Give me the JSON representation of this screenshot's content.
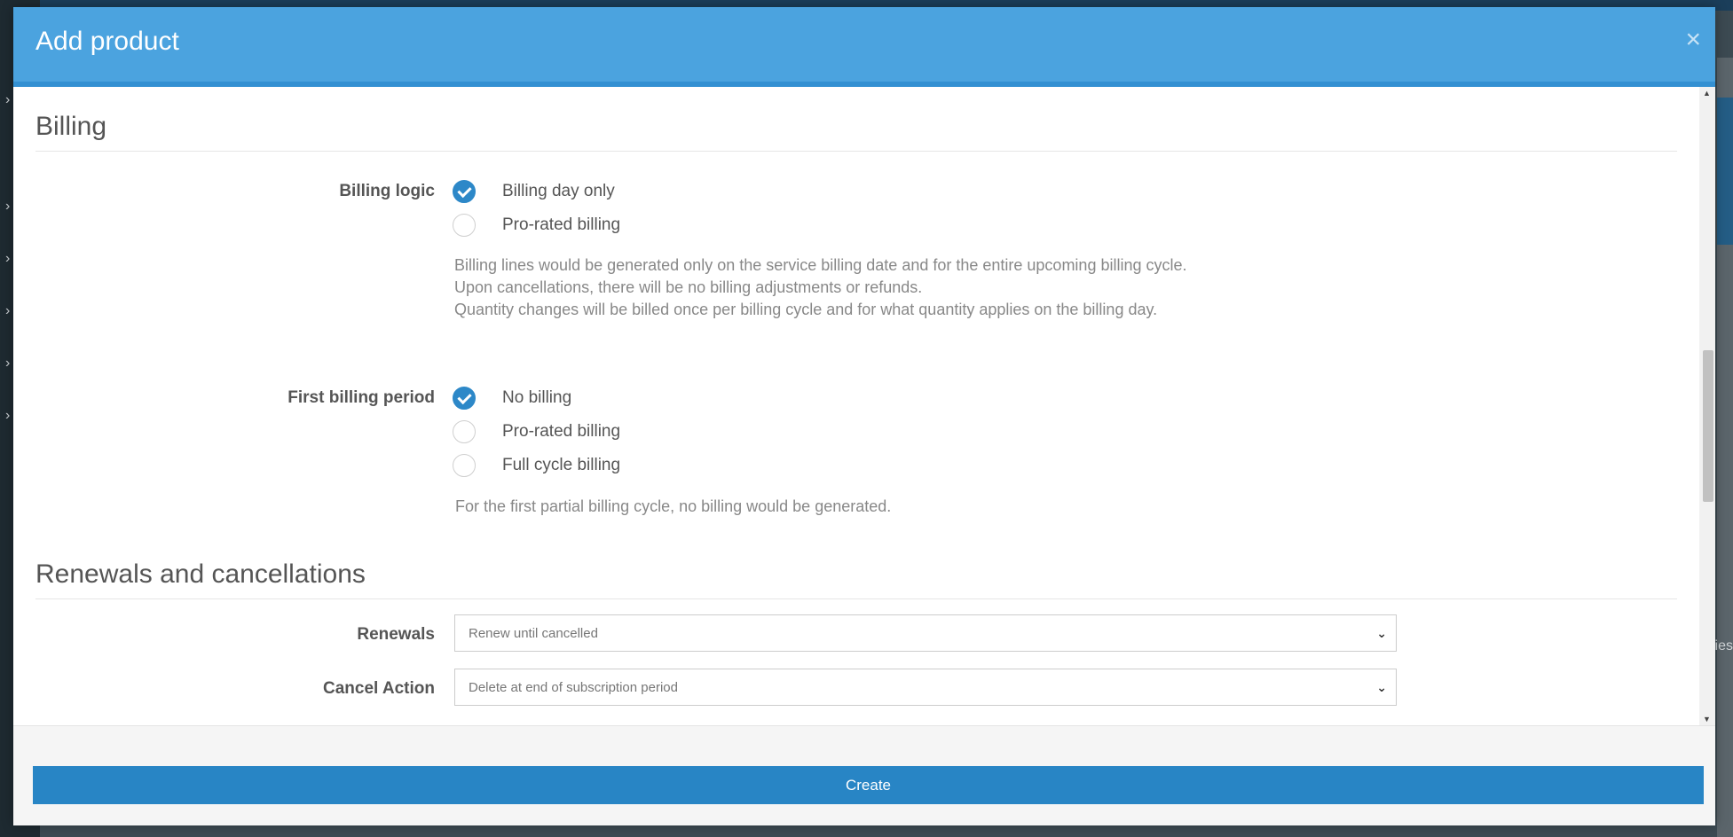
{
  "modal": {
    "title": "Add product",
    "close_glyph": "×"
  },
  "billing": {
    "section_title": "Billing",
    "billing_logic": {
      "label": "Billing logic",
      "options": [
        {
          "label": "Billing day only",
          "checked": true
        },
        {
          "label": "Pro-rated billing",
          "checked": false
        }
      ],
      "help": [
        "Billing lines would be generated only on the service billing date and for the entire upcoming billing cycle.",
        "Upon cancellations, there will be no billing adjustments or refunds.",
        "Quantity changes will be billed once per billing cycle and for what quantity applies on the billing day."
      ]
    },
    "first_billing_period": {
      "label": "First billing period",
      "options": [
        {
          "label": "No billing",
          "checked": true
        },
        {
          "label": "Pro-rated billing",
          "checked": false
        },
        {
          "label": "Full cycle billing",
          "checked": false
        }
      ],
      "help": "For the first partial billing cycle, no billing would be generated."
    }
  },
  "renewals": {
    "section_title": "Renewals and cancellations",
    "renewals_field": {
      "label": "Renewals",
      "value": "Renew until cancelled"
    },
    "cancel_action_field": {
      "label": "Cancel Action",
      "value": "Delete at end of subscription period"
    }
  },
  "footer": {
    "create_label": "Create"
  },
  "background": {
    "partial_text": "ies"
  },
  "colors": {
    "header": "#4ba3df",
    "accent": "#2d88c8",
    "button": "#2885c5"
  }
}
